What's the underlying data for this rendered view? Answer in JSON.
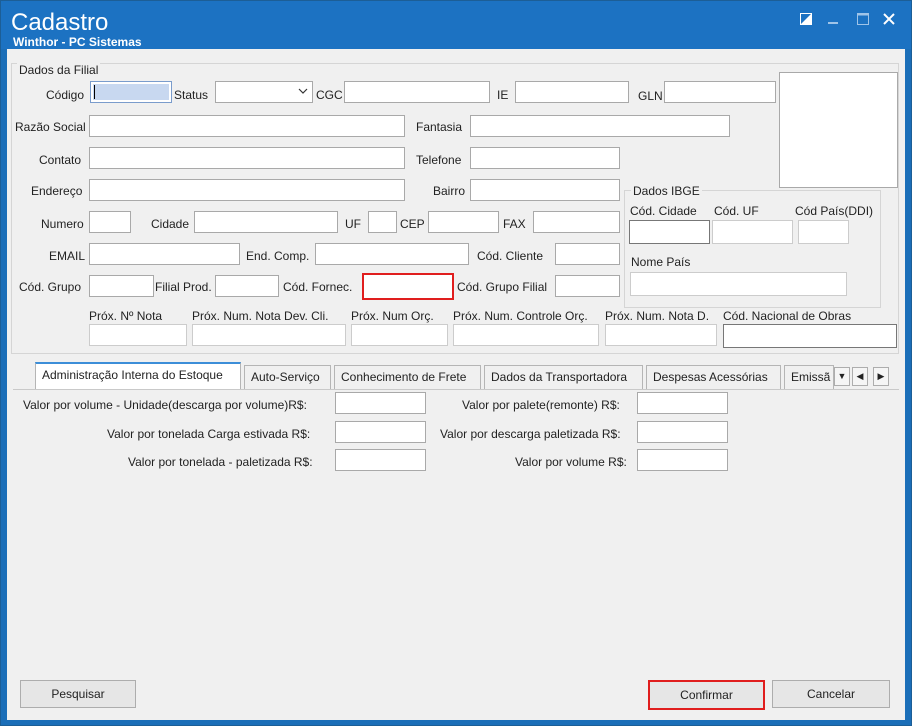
{
  "window": {
    "title": "Cadastro",
    "subtitle": "Winthor - PC Sistemas",
    "restore_icon": "restore-icon",
    "minimize_icon": "minimize-icon",
    "maximize_icon": "maximize-icon",
    "close_icon": "close-icon"
  },
  "dados_filial": {
    "group_title": "Dados da Filial",
    "codigo_label": "Código",
    "status_label": "Status",
    "status_value": "",
    "cgc_label": "CGC",
    "ie_label": "IE",
    "gln_label": "GLN",
    "razao_social_label": "Razão Social",
    "fantasia_label": "Fantasia",
    "contato_label": "Contato",
    "telefone_label": "Telefone",
    "endereco_label": "Endereço",
    "bairro_label": "Bairro",
    "numero_label": "Numero",
    "cidade_label": "Cidade",
    "uf_label": "UF",
    "cep_label": "CEP",
    "fax_label": "FAX",
    "email_label": "EMAIL",
    "end_comp_label": "End. Comp.",
    "cod_cliente_label": "Cód. Cliente",
    "cod_grupo_label": "Cód. Grupo",
    "filial_prod_label": "Filial Prod.",
    "cod_fornec_label": "Cód. Fornec.",
    "cod_grupo_filial_label": "Cód. Grupo Filial",
    "prox_nota_label": "Próx. Nº Nota",
    "prox_nota_dev_label": "Próx. Num. Nota Dev. Cli.",
    "prox_orc_label": "Próx. Num Orç.",
    "prox_controle_orc_label": "Próx. Num. Controle Orç.",
    "prox_nota_d_label": "Próx. Num. Nota D.",
    "cod_obras_label": "Cód. Nacional de Obras"
  },
  "dados_ibge": {
    "group_title": "Dados IBGE",
    "cod_cidade_label": "Cód. Cidade",
    "cod_uf_label": "Cód. UF",
    "cod_pais_label": "Cód País(DDI)",
    "nome_pais_label": "Nome País"
  },
  "tabs": [
    {
      "label": "Administração Interna do Estoque"
    },
    {
      "label": "Auto-Serviço"
    },
    {
      "label": "Conhecimento de Frete"
    },
    {
      "label": "Dados da Transportadora"
    },
    {
      "label": "Despesas Acessórias"
    },
    {
      "label": "Emissã"
    }
  ],
  "tab_content": {
    "valor_volume_unidade": "Valor por volume - Unidade(descarga por volume)R$:",
    "valor_tonelada_estivada": "Valor por tonelada Carga estivada R$:",
    "valor_tonelada_paletizada": "Valor por tonelada - paletizada R$:",
    "valor_palete": "Valor por palete(remonte) R$:",
    "valor_descarga_paletizada": "Valor por descarga paletizada R$:",
    "valor_volume": "Valor por volume R$:"
  },
  "buttons": {
    "pesquisar": "Pesquisar",
    "confirmar": "Confirmar",
    "cancelar": "Cancelar"
  }
}
